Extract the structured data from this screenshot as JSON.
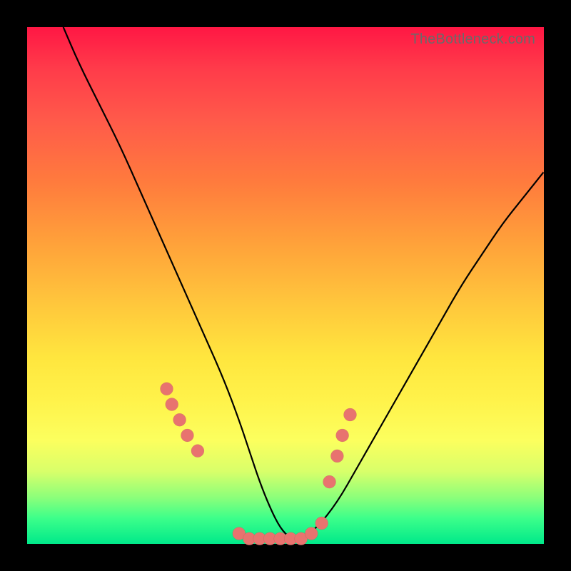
{
  "watermark": "TheBottleneck.com",
  "colors": {
    "background": "#000000",
    "curve": "#000000",
    "marker": "#e8736f"
  },
  "chart_data": {
    "type": "line",
    "title": "",
    "xlabel": "",
    "ylabel": "",
    "xlim": [
      0,
      100
    ],
    "ylim": [
      0,
      100
    ],
    "grid": false,
    "legend": false,
    "series": [
      {
        "name": "bottleneck-curve",
        "x": [
          7,
          10,
          14,
          18,
          22,
          26,
          30,
          34,
          38,
          41,
          43,
          45,
          47,
          49,
          51,
          53,
          56,
          60,
          64,
          68,
          72,
          76,
          80,
          84,
          88,
          92,
          96,
          100
        ],
        "y": [
          100,
          93,
          85,
          77,
          68,
          59,
          50,
          41,
          32,
          24,
          18,
          12,
          7,
          3,
          1,
          1,
          3,
          8,
          15,
          22,
          29,
          36,
          43,
          50,
          56,
          62,
          67,
          72
        ]
      },
      {
        "name": "highlight-markers",
        "x": [
          27,
          28,
          29.5,
          31,
          33,
          41,
          43,
          45,
          47,
          49,
          51,
          53,
          55,
          57,
          58.5,
          60,
          61,
          62.5
        ],
        "y": [
          30,
          27,
          24,
          21,
          18,
          2,
          1,
          1,
          1,
          1,
          1,
          1,
          2,
          4,
          12,
          17,
          21,
          25
        ]
      }
    ]
  }
}
